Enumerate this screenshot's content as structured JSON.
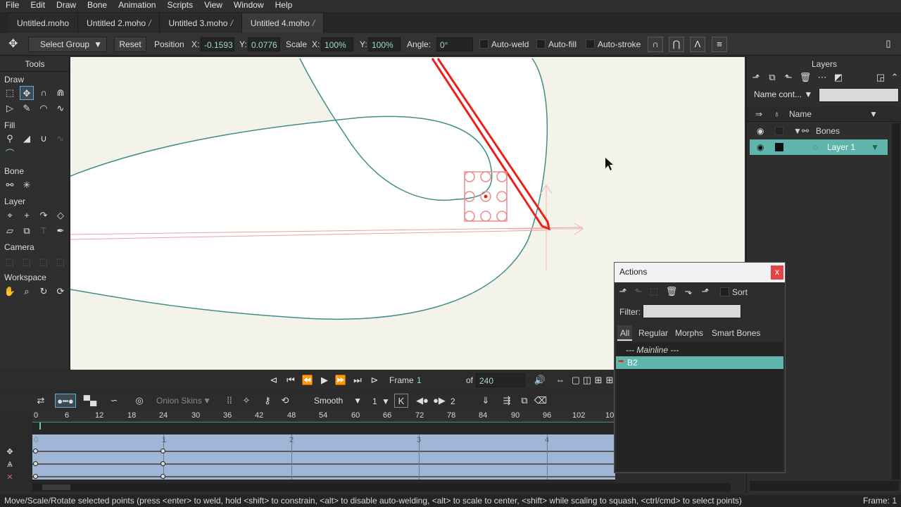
{
  "menu": [
    "File",
    "Edit",
    "Draw",
    "Bone",
    "Animation",
    "Scripts",
    "View",
    "Window",
    "Help"
  ],
  "tabs": [
    {
      "label": "Untitled.moho",
      "modified": false,
      "active": false
    },
    {
      "label": "Untitled 2.moho",
      "modified": true,
      "active": false
    },
    {
      "label": "Untitled 3.moho",
      "modified": true,
      "active": false
    },
    {
      "label": "Untitled 4.moho",
      "modified": true,
      "active": true
    }
  ],
  "options": {
    "select_group": "Select Group",
    "reset": "Reset",
    "position": "Position",
    "x_label": "X:",
    "x_value": "-0.1593",
    "y_label": "Y:",
    "y_value": "0.0776",
    "scale": "Scale",
    "sx_label": "X:",
    "sx_value": "100%",
    "sy_label": "Y:",
    "sy_value": "100%",
    "angle": "Angle:",
    "angle_value": "0°",
    "auto_weld": "Auto-weld",
    "auto_fill": "Auto-fill",
    "auto_stroke": "Auto-stroke"
  },
  "tools": {
    "title": "Tools",
    "sections": {
      "draw": "Draw",
      "fill": "Fill",
      "bone": "Bone",
      "layer": "Layer",
      "camera": "Camera",
      "workspace": "Workspace"
    }
  },
  "layers": {
    "title": "Layers",
    "name_filter": "Name cont...",
    "column_name": "Name",
    "items": [
      {
        "label": "Bones",
        "type": "bone-group",
        "selected": false
      },
      {
        "label": "Layer 1",
        "type": "vector",
        "selected": true
      }
    ]
  },
  "actions": {
    "title": "Actions",
    "close": "x",
    "sort": "Sort",
    "filter_label": "Filter:",
    "tabs": [
      "All",
      "Regular",
      "Morphs",
      "Smart Bones"
    ],
    "mainline": "--- Mainline ---",
    "items": [
      {
        "label": "B2",
        "selected": true
      }
    ]
  },
  "playback": {
    "frame_label": "Frame",
    "frame_value": "1",
    "of_label": "of",
    "total": "240"
  },
  "timeline": {
    "onion": "Onion Skins",
    "interp": "Smooth",
    "interp_count": "1",
    "ease_count": "2",
    "ruler": [
      "0",
      "6",
      "12",
      "18",
      "24",
      "30",
      "36",
      "42",
      "48",
      "54",
      "60",
      "66",
      "72",
      "78",
      "84",
      "90",
      "96",
      "102",
      "10"
    ],
    "seconds": [
      "0",
      "1",
      "2",
      "3",
      "4"
    ]
  },
  "status": {
    "message": "Move/Scale/Rotate selected points (press <enter> to weld, hold <shift> to constrain, <alt> to disable auto-welding, <alt> to scale to center, <shift> while scaling to squash, <ctrl/cmd> to select points)",
    "frame": "Frame: 1"
  },
  "colors": {
    "accent": "#6fc7bd",
    "selection": "#5fb5ac",
    "bone": "#e8201e",
    "curve": "#3e8f87"
  }
}
